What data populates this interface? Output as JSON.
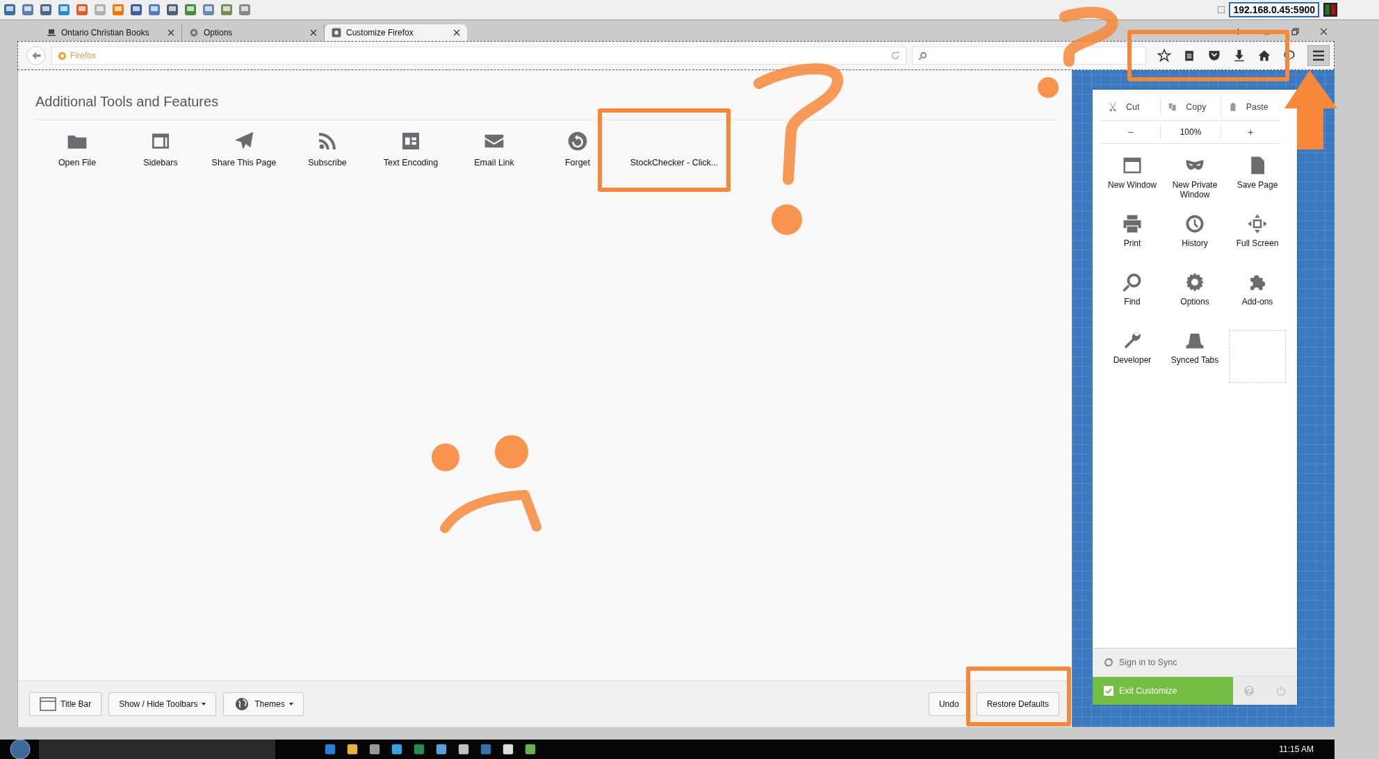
{
  "remote_toolbar": {
    "address": "192.168.0.45:5900"
  },
  "tabs": [
    {
      "label": "Ontario Christian Books",
      "selected": false
    },
    {
      "label": "Options",
      "selected": false
    },
    {
      "label": "Customize Firefox",
      "selected": true
    }
  ],
  "nav_bar": {
    "identity_label": "Firefox"
  },
  "palette": {
    "title": "Additional Tools and Features",
    "items": [
      {
        "label": "Open File"
      },
      {
        "label": "Sidebars"
      },
      {
        "label": "Share This Page"
      },
      {
        "label": "Subscribe"
      },
      {
        "label": "Text Encoding"
      },
      {
        "label": "Email Link"
      },
      {
        "label": "Forget"
      },
      {
        "label": "StockChecker - Click..."
      }
    ]
  },
  "menu_panel": {
    "edit_row": [
      "Cut",
      "Copy",
      "Paste"
    ],
    "zoom_row": [
      "−",
      "100%",
      "+"
    ],
    "items": [
      {
        "label": "New Window"
      },
      {
        "label": "New Private Window"
      },
      {
        "label": "Save Page"
      },
      {
        "label": "Print"
      },
      {
        "label": "History"
      },
      {
        "label": "Full Screen"
      },
      {
        "label": "Find"
      },
      {
        "label": "Options"
      },
      {
        "label": "Add-ons"
      },
      {
        "label": "Developer"
      },
      {
        "label": "Synced Tabs"
      }
    ],
    "sync_label": "Sign in to Sync",
    "exit_label": "Exit Customize"
  },
  "bottom_bar": {
    "left_buttons": [
      {
        "label": "Title Bar",
        "dropdown": false
      },
      {
        "label": "Show / Hide Toolbars",
        "dropdown": true
      },
      {
        "label": "Themes",
        "dropdown": true
      }
    ],
    "right_buttons": [
      "Undo",
      "Restore Defaults"
    ]
  },
  "taskbar": {
    "clock": "11:15 AM"
  }
}
